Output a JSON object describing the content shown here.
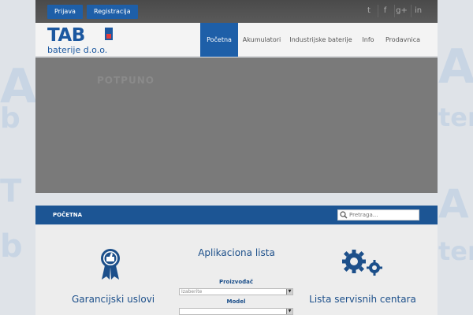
{
  "top": {
    "login_label": "Prijava",
    "register_label": "Registracija",
    "social": [
      "t",
      "f",
      "g+",
      "in"
    ]
  },
  "logo": {
    "name": "TAB",
    "subtitle": "baterije d.o.o."
  },
  "nav": {
    "items": [
      {
        "label": "Početna",
        "active": true
      },
      {
        "label": "Akumulatori",
        "active": false
      },
      {
        "label": "Industrijske baterije",
        "active": false
      },
      {
        "label": "Info",
        "active": false
      },
      {
        "label": "Prodavnica",
        "active": false
      }
    ]
  },
  "slider": {
    "ghost_text": "POTPUNO"
  },
  "breadcrumb": {
    "current": "POČETNA"
  },
  "search": {
    "placeholder": "Pretraga..."
  },
  "content": {
    "warranty_title": "Garancijski uslovi",
    "app_list_title": "Aplikaciona lista",
    "manufacturer_label": "Proizvođač",
    "manufacturer_value": "Izaberite",
    "model_label": "Model",
    "model_value": "",
    "service_title": "Lista servisnih centara"
  },
  "colors": {
    "brand_blue": "#1e5fa8",
    "dark_blue": "#1c5594",
    "accent_red": "#e23b3b"
  }
}
